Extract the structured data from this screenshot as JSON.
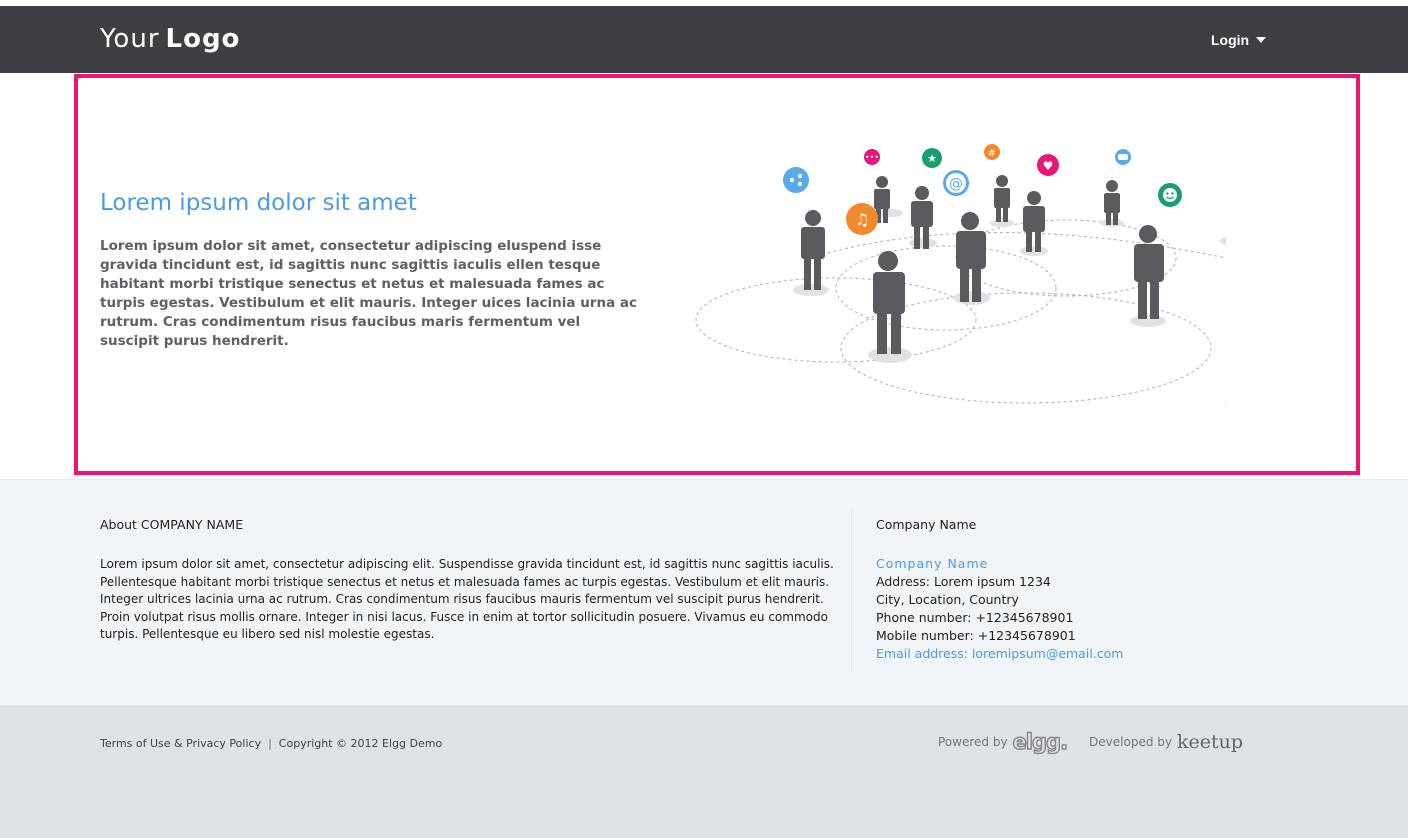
{
  "header": {
    "logo_light": "Your",
    "logo_bold": "Logo",
    "login_label": "Login"
  },
  "hero": {
    "title": "Lorem ipsum dolor sit amet",
    "text": "Lorem ipsum dolor sit amet, consectetur adipiscing eluspend isse gravida tincidunt est, id sagittis nunc sagittis iaculis ellen tesque habitant morbi tristique senectus et netus et malesuada fames ac turpis egestas. Vestibulum et elit mauris. Integer uices lacinia urna ac rutrum. Cras condimentum risus faucibus maris fermentum vel suscipit purus hendrerit.",
    "accent_color": "#4a9be6",
    "border_color": "#ee1470"
  },
  "about": {
    "title": "About COMPANY NAME",
    "text": "Lorem ipsum dolor sit amet, consectetur adipiscing elit. Suspendisse gravida tincidunt est, id sagittis nunc sagittis iaculis. Pellentesque habitant morbi tristique senectus et netus et malesuada fames ac turpis egestas. Vestibulum et elit mauris. Integer ultrices lacinia urna ac rutrum. Cras condimentum risus faucibus mauris fermentum vel suscipit purus hendrerit. Proin volutpat risus mollis ornare. Integer in nisi lacus. Fusce in enim at tortor sollicitudin posuere. Vivamus eu commodo turpis. Pellentesque eu libero sed nisl molestie egestas."
  },
  "company": {
    "title": "Company Name",
    "name_link": "Company Name",
    "address": "Address: Lorem ipsum 1234",
    "city": "City, Location, Country",
    "phone": "Phone number: +12345678901",
    "mobile": "Mobile number: +12345678901",
    "email": "Email address: loremipsum@email.com"
  },
  "footer": {
    "terms": "Terms of Use & Privacy Policy",
    "separator": "|",
    "copyright": "Copyright © 2012 Elgg Demo",
    "powered_by": "Powered by",
    "elgg": "elgg.",
    "developed_by": "Developed by",
    "keetup": "keetup"
  },
  "icons": [
    "share-icon",
    "chat-icon",
    "star-icon",
    "hash-icon",
    "at-icon",
    "heart-icon",
    "music-icon",
    "car-icon",
    "smiley-icon",
    "alert-icon",
    "thumbs-up-icon"
  ]
}
